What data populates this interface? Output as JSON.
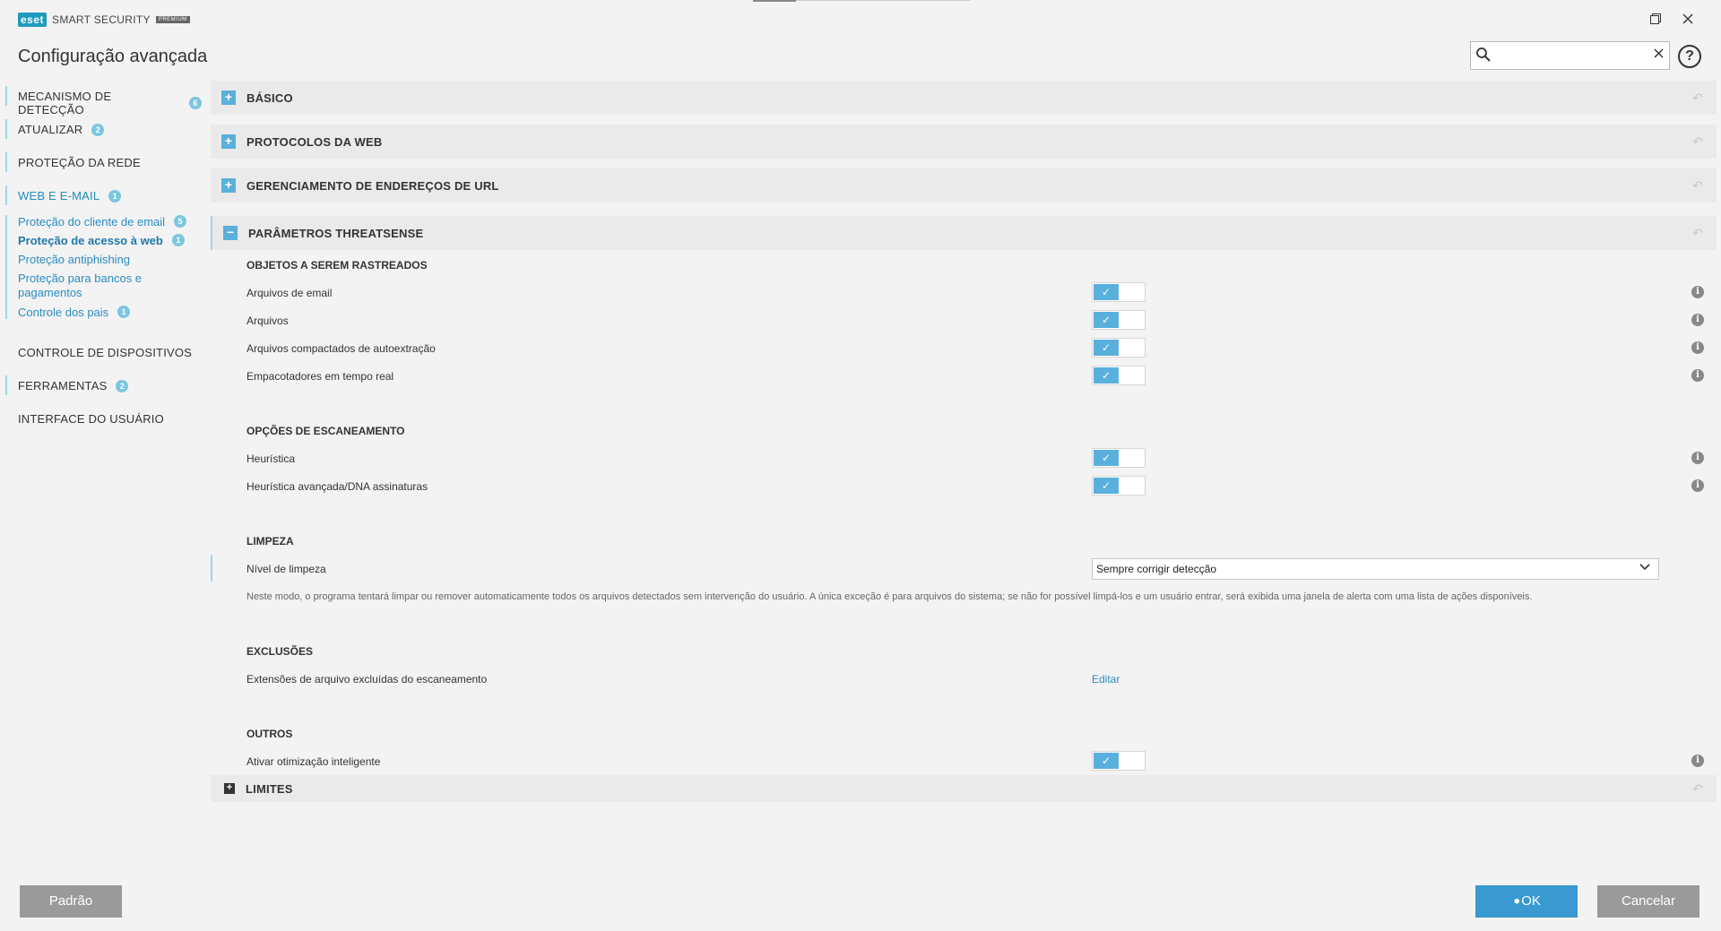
{
  "app": {
    "logo_mark": "eset",
    "product": "SMART SECURITY",
    "edition": "PREMIUM",
    "title": "Configuração avançada"
  },
  "window": {
    "restore_icon": "restore-icon",
    "close_icon": "close-icon"
  },
  "search": {
    "value": "",
    "placeholder": ""
  },
  "help_label": "?",
  "sidebar": {
    "items": [
      {
        "label": "MECANISMO DE DETECÇÃO",
        "badge": "6"
      },
      {
        "label": "ATUALIZAR",
        "badge": "2"
      },
      {
        "label": "PROTEÇÃO DA REDE",
        "badge": ""
      },
      {
        "label": "WEB E E-MAIL",
        "badge": "1"
      },
      {
        "label": "CONTROLE DE DISPOSITIVOS",
        "badge": ""
      },
      {
        "label": "FERRAMENTAS",
        "badge": "2"
      },
      {
        "label": "INTERFACE DO USUÁRIO",
        "badge": ""
      }
    ],
    "sub_items": [
      {
        "label": "Proteção do cliente de email",
        "badge": "5"
      },
      {
        "label": "Proteção de acesso à web",
        "badge": "1"
      },
      {
        "label": "Proteção antiphishing",
        "badge": ""
      },
      {
        "label": "Proteção para bancos e pagamentos",
        "badge": ""
      },
      {
        "label": "Controle dos pais",
        "badge": "1"
      }
    ]
  },
  "sections": {
    "basic": "BÁSICO",
    "web_protocols": "PROTOCOLOS DA WEB",
    "url_management": "GERENCIAMENTO DE ENDEREÇOS DE URL",
    "threatsense": "PARÂMETROS THREATSENSE",
    "limits": "LIMITES"
  },
  "threatsense": {
    "objects_title": "OBJETOS A SEREM RASTREADOS",
    "objects": [
      {
        "label": "Arquivos de email",
        "enabled": true
      },
      {
        "label": "Arquivos",
        "enabled": true
      },
      {
        "label": "Arquivos compactados de autoextração",
        "enabled": true
      },
      {
        "label": "Empacotadores em tempo real",
        "enabled": true
      }
    ],
    "scan_options_title": "OPÇÕES DE ESCANEAMENTO",
    "scan_options": [
      {
        "label": "Heurística",
        "enabled": true
      },
      {
        "label": "Heurística avançada/DNA assinaturas",
        "enabled": true
      }
    ],
    "cleaning_title": "LIMPEZA",
    "cleaning_level_label": "Nível de limpeza",
    "cleaning_level_value": "Sempre corrigir detecção",
    "cleaning_description": "Neste modo, o programa tentará limpar ou remover automaticamente todos os arquivos detectados sem intervenção do usuário. A única exceção é para arquivos do sistema; se não for possível limpá-los e um usuário entrar, será exibida uma janela de alerta com uma lista de ações disponíveis.",
    "exclusions_title": "EXCLUSÕES",
    "exclusions_label": "Extensões de arquivo excluídas do escaneamento",
    "exclusions_link": "Editar",
    "other_title": "OUTROS",
    "smart_optimization_label": "Ativar otimização inteligente",
    "smart_optimization_enabled": true
  },
  "footer": {
    "default_label": "Padrão",
    "ok_label": "OK",
    "cancel_label": "Cancelar"
  },
  "colors": {
    "accent": "#5ab0dc",
    "link": "#2a8dc4",
    "button_gray": "#9a9a9a",
    "button_ok": "#3a99d0"
  }
}
